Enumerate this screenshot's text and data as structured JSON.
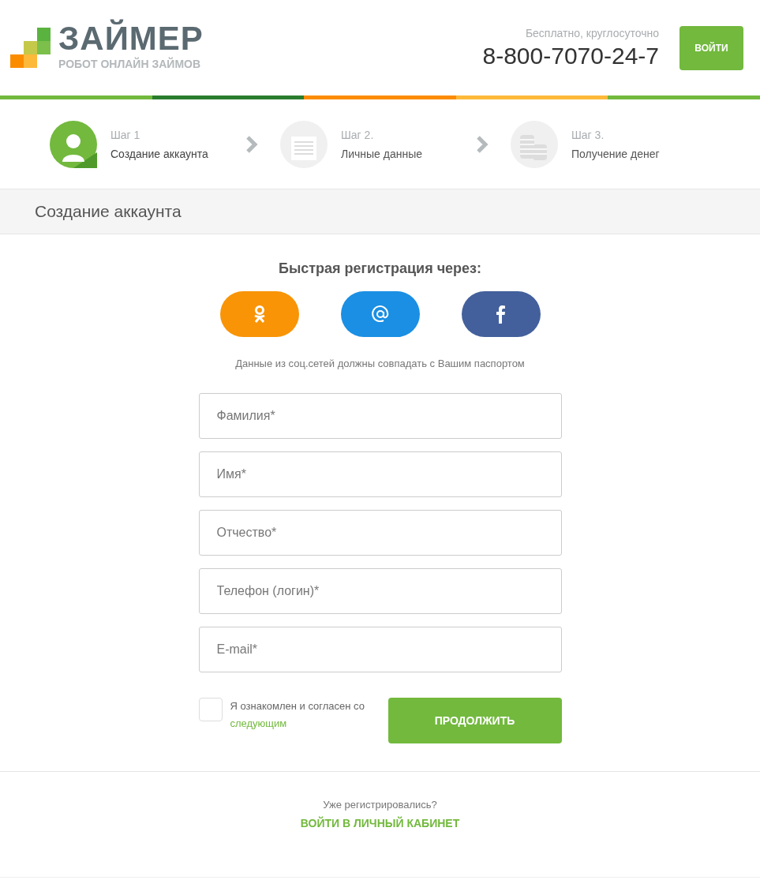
{
  "header": {
    "logo_title": "ЗАЙМЕР",
    "logo_subtitle": "РОБОТ ОНЛАЙН ЗАЙМОВ",
    "phone_note": "Бесплатно, круглосуточно",
    "phone": "8-800-7070-24-7",
    "login_button": "ВОЙТИ"
  },
  "steps": [
    {
      "kind": "account",
      "step": "Шаг 1",
      "label": "Создание аккаунта",
      "selected": true
    },
    {
      "kind": "personal",
      "step": "Шаг 2.",
      "label": "Личные данные",
      "selected": false
    },
    {
      "kind": "money",
      "step": "Шаг 3.",
      "label": "Получение денег",
      "selected": false
    }
  ],
  "section_title": "Создание аккаунта",
  "social": {
    "title": "Быстрая регистрация через:",
    "buttons": [
      {
        "kind": "ok",
        "color": "#f89406"
      },
      {
        "kind": "mail",
        "color": "#1a8fe3"
      },
      {
        "kind": "facebook",
        "color": "#43609c"
      }
    ],
    "note": "Данные из соц.сетей должны совпадать с Вашим паспортом"
  },
  "fields": [
    {
      "placeholder": "Фамилия*"
    },
    {
      "placeholder": "Имя*"
    },
    {
      "placeholder": "Отчество*"
    },
    {
      "placeholder": "Телефон (логин)*"
    },
    {
      "placeholder": "E-mail*"
    }
  ],
  "agreement": {
    "checked": false,
    "text": "Я ознакомлен и согласен со",
    "link": "следующим"
  },
  "continue_button": "ПРОДОЛЖИТЬ",
  "footer": {
    "question": "Уже регистрировались?",
    "link": "ВОЙТИ В ЛИЧНЫЙ КАБИНЕТ"
  }
}
